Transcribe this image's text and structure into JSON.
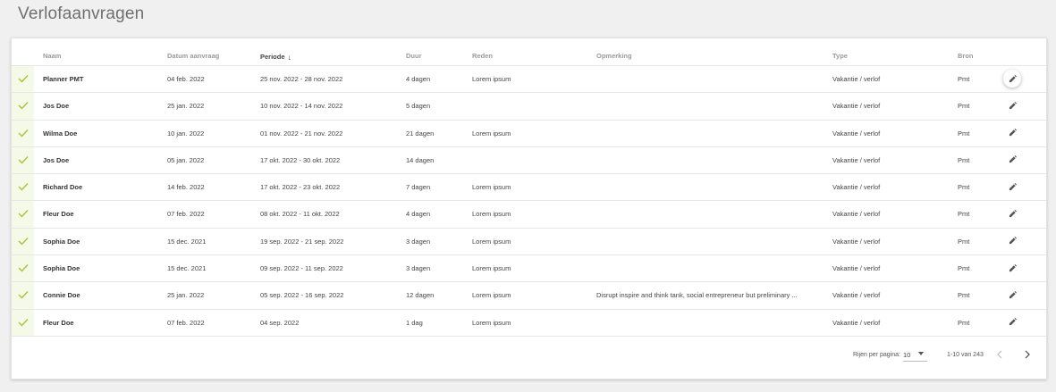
{
  "page": {
    "title": "Verlofaanvragen"
  },
  "table": {
    "columns": {
      "name": "Naam",
      "requested": "Datum aanvraag",
      "period": "Periode",
      "duration": "Duur",
      "reason": "Reden",
      "remark": "Opmerking",
      "type": "Type",
      "source": "Bron"
    },
    "sorted_column": "period",
    "sort_direction": "descending",
    "rows": [
      {
        "status": "approved",
        "name": "Planner PMT",
        "requested": "04 feb. 2022",
        "period": "25 nov. 2022 - 28 nov. 2022",
        "duration": "4 dagen",
        "reason": "Lorem ipsum",
        "remark": "",
        "type": "Vakantie / verlof",
        "source": "Pmt"
      },
      {
        "status": "approved",
        "name": "Jos Doe",
        "requested": "25 jan. 2022",
        "period": "10 nov. 2022 - 14 nov. 2022",
        "duration": "5 dagen",
        "reason": "",
        "remark": "",
        "type": "Vakantie / verlof",
        "source": "Pmt"
      },
      {
        "status": "approved",
        "name": "Wilma Doe",
        "requested": "10 jan. 2022",
        "period": "01 nov. 2022 - 21 nov. 2022",
        "duration": "21 dagen",
        "reason": "Lorem ipsum",
        "remark": "",
        "type": "Vakantie / verlof",
        "source": "Pmt"
      },
      {
        "status": "approved",
        "name": "Jos Doe",
        "requested": "05 jan. 2022",
        "period": "17 okt. 2022 - 30 okt. 2022",
        "duration": "14 dagen",
        "reason": "",
        "remark": "",
        "type": "Vakantie / verlof",
        "source": "Pmt"
      },
      {
        "status": "approved",
        "name": "Richard Doe",
        "requested": "14 feb. 2022",
        "period": "17 okt. 2022 - 23 okt. 2022",
        "duration": "7 dagen",
        "reason": "Lorem ipsum",
        "remark": "",
        "type": "Vakantie / verlof",
        "source": "Pmt"
      },
      {
        "status": "approved",
        "name": "Fleur Doe",
        "requested": "07 feb. 2022",
        "period": "08 okt. 2022 - 11 okt. 2022",
        "duration": "4 dagen",
        "reason": "Lorem ipsum",
        "remark": "",
        "type": "Vakantie / verlof",
        "source": "Pmt"
      },
      {
        "status": "approved",
        "name": "Sophia Doe",
        "requested": "15 dec. 2021",
        "period": "19 sep. 2022 - 21 sep. 2022",
        "duration": "3 dagen",
        "reason": "Lorem ipsum",
        "remark": "",
        "type": "Vakantie / verlof",
        "source": "Pmt"
      },
      {
        "status": "approved",
        "name": "Sophia Doe",
        "requested": "15 dec. 2021",
        "period": "09 sep. 2022 - 11 sep. 2022",
        "duration": "3 dagen",
        "reason": "Lorem ipsum",
        "remark": "",
        "type": "Vakantie / verlof",
        "source": "Pmt"
      },
      {
        "status": "approved",
        "name": "Connie Doe",
        "requested": "25 jan. 2022",
        "period": "05 sep. 2022 - 16 sep. 2022",
        "duration": "12 dagen",
        "reason": "Lorem ipsum",
        "remark": "Disrupt inspire and think tank, social entrepreneur but preliminary ...",
        "type": "Vakantie / verlof",
        "source": "Pmt"
      },
      {
        "status": "approved",
        "name": "Fleur Doe",
        "requested": "07 feb. 2022",
        "period": "04 sep. 2022",
        "duration": "1 dag",
        "reason": "Lorem ipsum",
        "remark": "",
        "type": "Vakantie / verlof",
        "source": "Pmt"
      }
    ]
  },
  "pagination": {
    "rows_per_page_label": "Rijen per pagina:",
    "rows_per_page_value": "10",
    "range_text": "1-10 van 243"
  },
  "colors": {
    "check": "#a6c33a",
    "status_bg": "#f5f9e8",
    "header_text": "#9a9a9a"
  },
  "icons": {
    "status": "check-icon",
    "row_action": "pencil-icon",
    "sort": "arrow-down-icon",
    "dropdown": "caret-down-icon",
    "prev": "chevron-left-icon",
    "next": "chevron-right-icon"
  }
}
